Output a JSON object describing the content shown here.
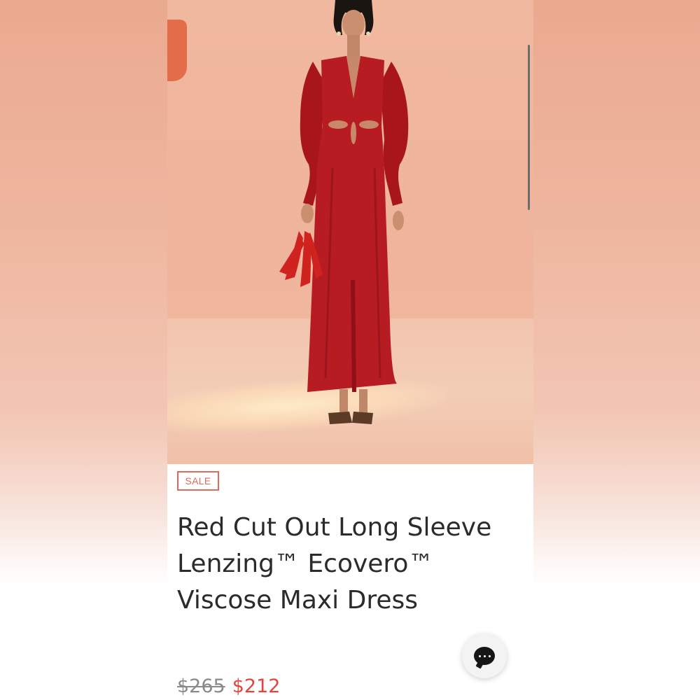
{
  "product": {
    "badge": "SALE",
    "title": "Red Cut Out Long Sleeve Lenzing™ Ecovero™ Viscose Maxi Dress",
    "price_original": "$265",
    "price_sale": "$212"
  },
  "icons": {
    "chat": "chat-bubble-icon"
  },
  "colors": {
    "sale_accent": "#e0685d",
    "sale_price": "#e0463b",
    "dress": "#b71c22",
    "photo_background": "#efb49b"
  }
}
